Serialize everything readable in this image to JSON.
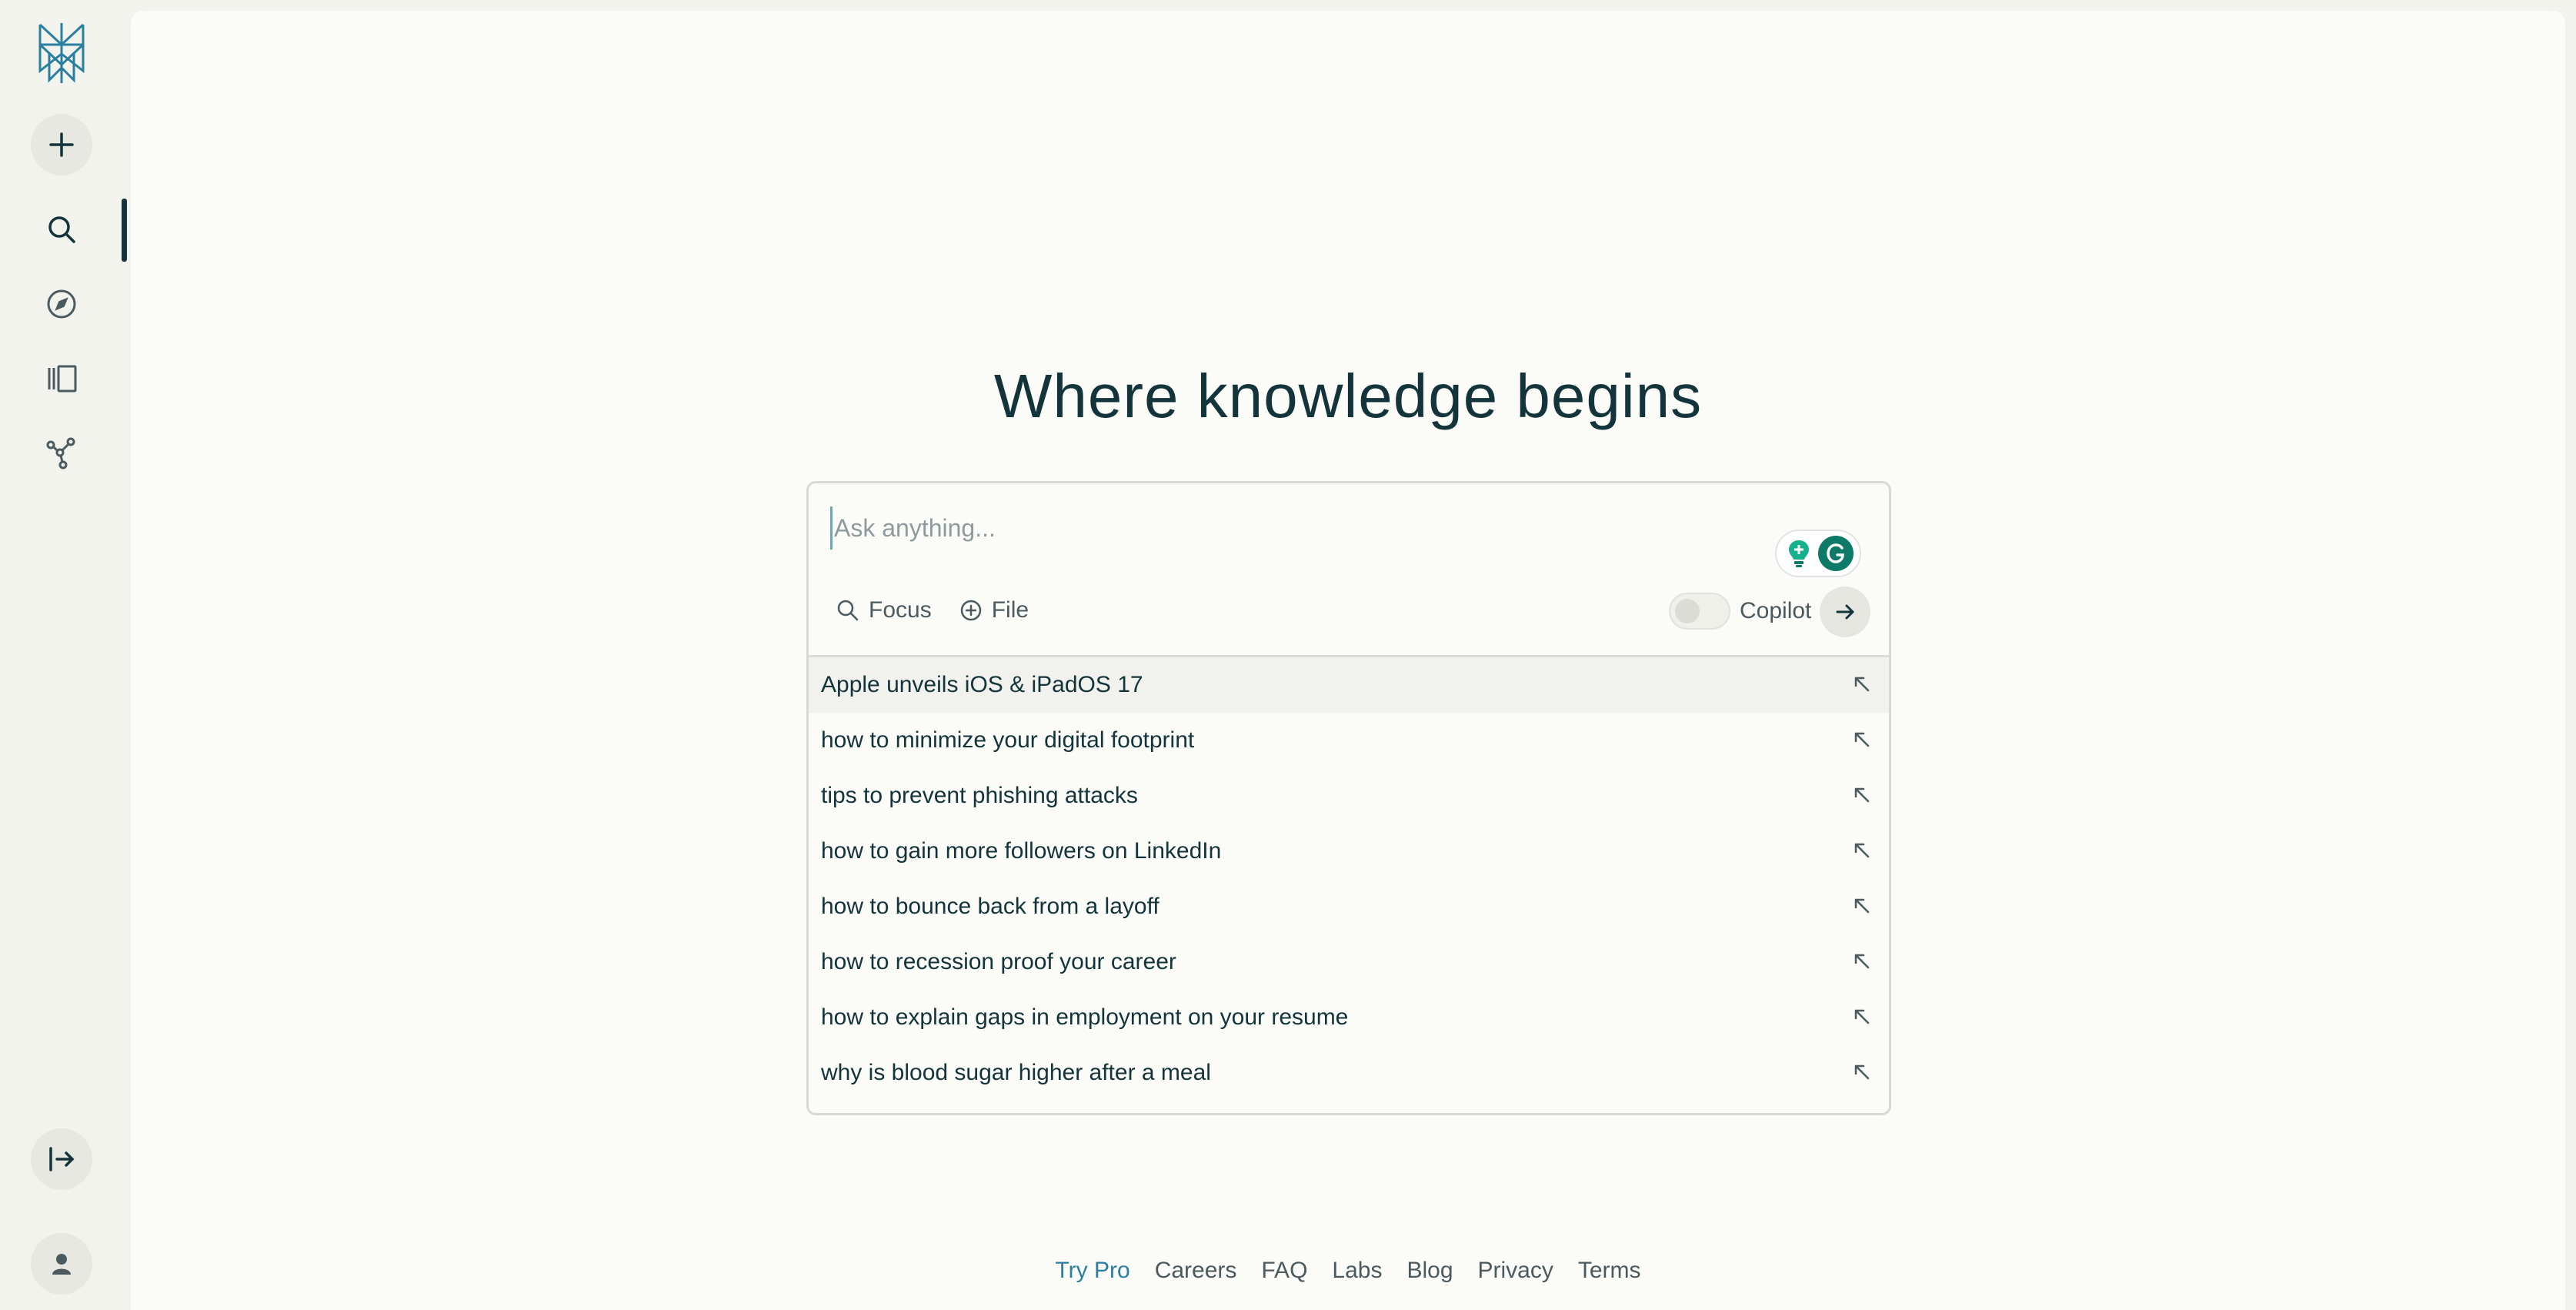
{
  "sidebar": {
    "items": [
      {
        "name": "new-thread",
        "icon": "plus-icon"
      },
      {
        "name": "home",
        "icon": "search-icon",
        "active": true
      },
      {
        "name": "discover",
        "icon": "compass-icon"
      },
      {
        "name": "library",
        "icon": "library-icon"
      },
      {
        "name": "share",
        "icon": "share-icon"
      }
    ],
    "bottom": [
      {
        "name": "expand",
        "icon": "expand-sidebar-icon"
      },
      {
        "name": "account",
        "icon": "user-icon"
      }
    ]
  },
  "main": {
    "headline": "Where knowledge begins",
    "search": {
      "placeholder": "Ask anything...",
      "focus_label": "Focus",
      "file_label": "File",
      "copilot_label": "Copilot",
      "copilot_on": false
    },
    "suggestions": [
      "Apple unveils iOS & iPadOS 17",
      "how to minimize your digital footprint",
      "tips to prevent phishing attacks",
      "how to gain more followers on LinkedIn",
      "how to bounce back from a layoff",
      "how to recession proof your career",
      "how to explain gaps in employment on your resume",
      "why is blood sugar higher after a meal"
    ]
  },
  "footer": {
    "links": [
      "Try Pro",
      "Careers",
      "FAQ",
      "Labs",
      "Blog",
      "Privacy",
      "Terms"
    ]
  },
  "colors": {
    "accent": "#2a7fa0",
    "text": "#13343b",
    "grammarly": "#0d7a68",
    "sidebar_bg": "#f3f3ee",
    "main_bg": "#fbfbf8"
  }
}
